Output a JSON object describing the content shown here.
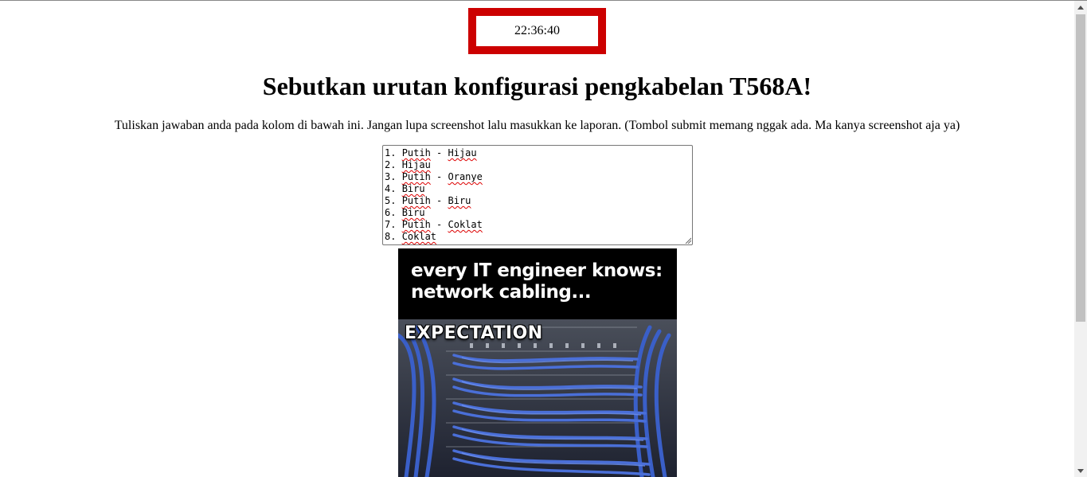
{
  "clock": {
    "time": "22:36:40"
  },
  "question": {
    "title": "Sebutkan urutan konfigurasi pengkabelan T568A!"
  },
  "instructions": {
    "text": "Tuliskan jawaban anda pada kolom di bawah ini. Jangan lupa screenshot lalu masukkan ke laporan. (Tombol submit memang nggak ada. Ma kanya screenshot aja ya)"
  },
  "answer": {
    "lines": [
      {
        "num": "1.",
        "parts": [
          "Putih",
          " - ",
          "Hijau"
        ]
      },
      {
        "num": "2.",
        "parts": [
          "Hijau"
        ]
      },
      {
        "num": "3.",
        "parts": [
          "Putih",
          " - ",
          "Oranye"
        ]
      },
      {
        "num": "4.",
        "parts": [
          "Biru"
        ]
      },
      {
        "num": "5.",
        "parts": [
          "Putih",
          " - ",
          "Biru"
        ]
      },
      {
        "num": "6.",
        "parts": [
          "Biru"
        ]
      },
      {
        "num": "7.",
        "parts": [
          "Putih",
          " - ",
          "Coklat"
        ]
      },
      {
        "num": "8.",
        "parts": [
          "Coklat"
        ]
      }
    ]
  },
  "meme": {
    "caption_line1": "every IT engineer knows:",
    "caption_line2": "network cabling...",
    "label": "EXPECTATION"
  },
  "colors": {
    "clock_border": "#cc0000",
    "cable_blue": "#3a5fc8",
    "scrollbar_thumb": "#c1c1c1"
  },
  "icons": {
    "scroll_up": "arrow-up-icon",
    "scroll_down": "arrow-down-icon",
    "resize": "resize-grip-icon"
  }
}
